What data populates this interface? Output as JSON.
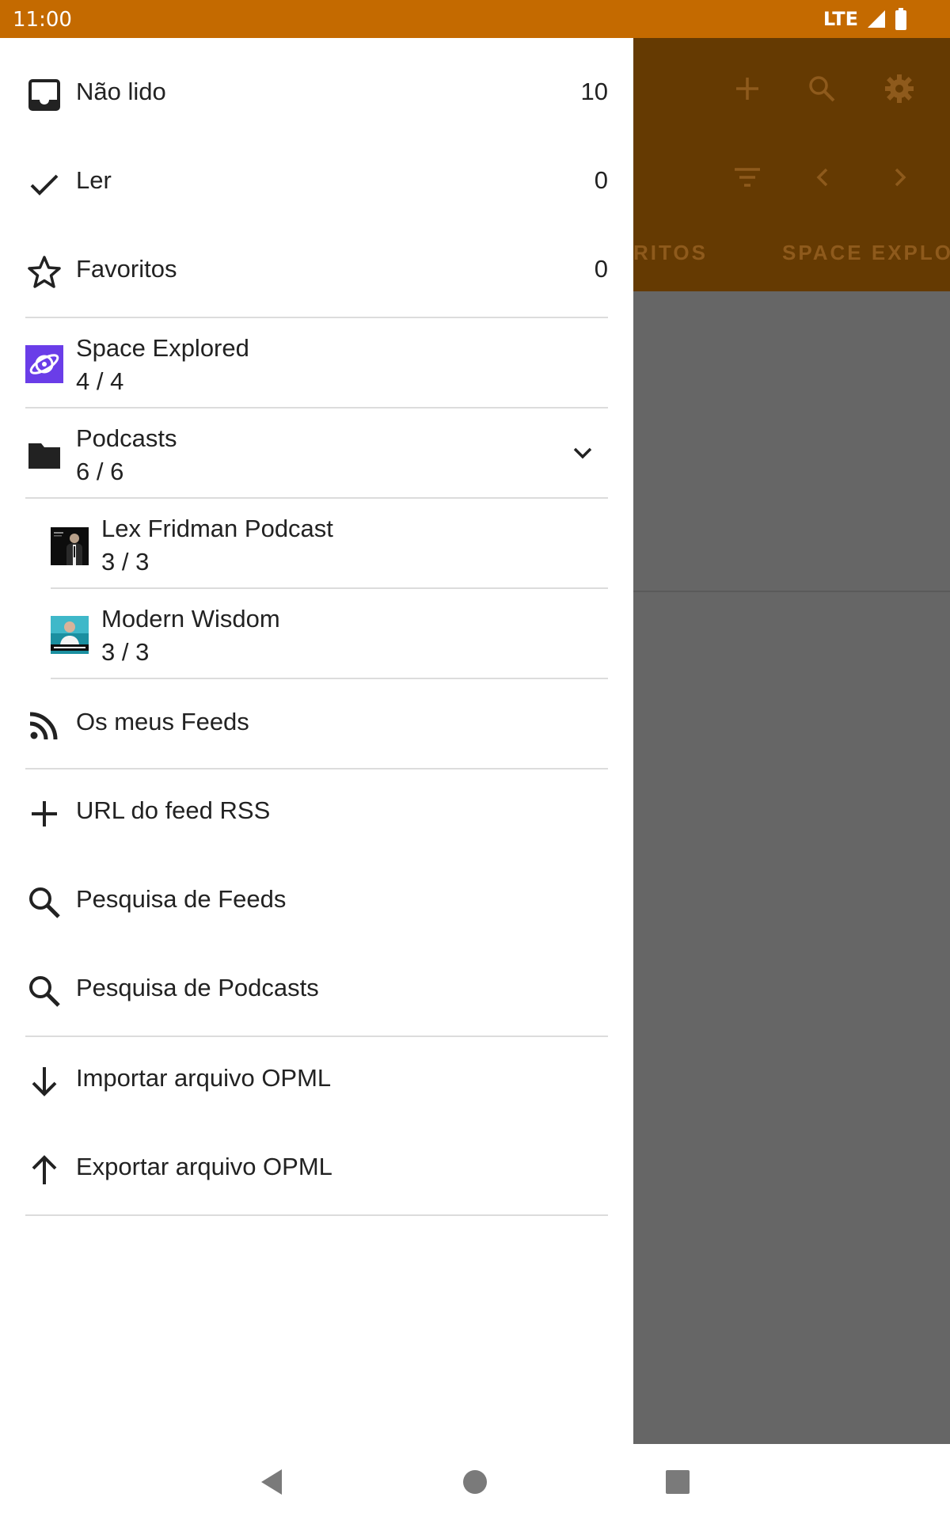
{
  "status_bar": {
    "time": "11:00",
    "network": "LTE",
    "icons": [
      "signal-icon",
      "battery-icon"
    ]
  },
  "background_app": {
    "toolbar_icons": [
      "add-icon",
      "search-icon",
      "settings-icon",
      "filter-icon",
      "chevron-left-icon",
      "chevron-right-icon"
    ],
    "tabs": [
      "RITOS",
      "SPACE EXPLOI"
    ],
    "accent_color": "#c46a00"
  },
  "drawer": {
    "filters": [
      {
        "label": "Não lido",
        "count": "10",
        "icon": "inbox-icon"
      },
      {
        "label": "Ler",
        "count": "0",
        "icon": "check-icon"
      },
      {
        "label": "Favoritos",
        "count": "0",
        "icon": "star-icon"
      }
    ],
    "feeds": [
      {
        "title": "Space Explored",
        "counts": "4 / 4",
        "icon": "space-explored-logo"
      },
      {
        "title": "Podcasts",
        "counts": "6 / 6",
        "icon": "folder-icon",
        "expanded": true
      },
      {
        "title": "Lex Fridman Podcast",
        "counts": "3 / 3",
        "icon": "lex-fridman-thumbnail"
      },
      {
        "title": "Modern Wisdom",
        "counts": "3 / 3",
        "icon": "modern-wisdom-thumbnail"
      }
    ],
    "my_feeds": {
      "label": "Os meus Feeds",
      "icon": "rss-icon"
    },
    "actions": [
      {
        "label": "URL do feed RSS",
        "icon": "add-icon"
      },
      {
        "label": "Pesquisa de Feeds",
        "icon": "search-icon"
      },
      {
        "label": "Pesquisa de Podcasts",
        "icon": "search-icon"
      }
    ],
    "opml": [
      {
        "label": "Importar arquivo OPML",
        "icon": "arrow-down-icon"
      },
      {
        "label": "Exportar arquivo OPML",
        "icon": "arrow-up-icon"
      }
    ]
  },
  "nav_bar": {
    "buttons": [
      "back-icon",
      "home-icon",
      "recents-icon"
    ]
  }
}
